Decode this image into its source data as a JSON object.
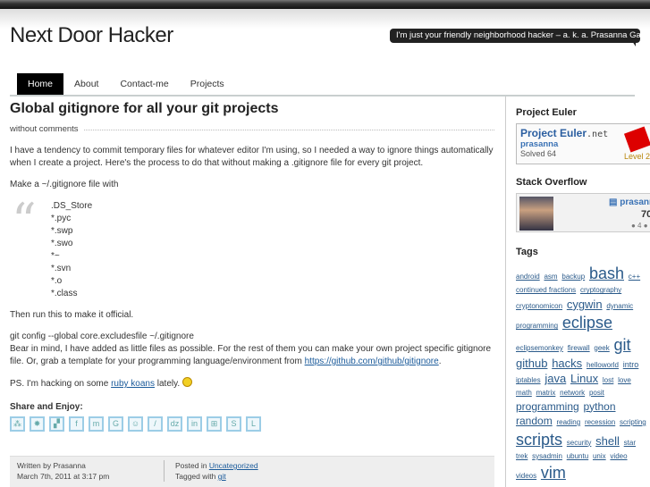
{
  "site": {
    "title": "Next Door Hacker",
    "tagline": "I'm just your friendly neighborhood hacker – a. k. a. Prasanna Gautam"
  },
  "nav": [
    {
      "label": "Home",
      "active": true
    },
    {
      "label": "About"
    },
    {
      "label": "Contact-me"
    },
    {
      "label": "Projects"
    }
  ],
  "post": {
    "title": "Global gitignore for all your git projects",
    "comments": "without comments",
    "p1": "I have a tendency to commit temporary files for whatever editor I'm using, so I needed a way to ignore things automatically when I create a project. Here's the process to do that without making a .gitignore file for every git project.",
    "p2": "Make a ~/.gitignore file with",
    "quote_lines": [
      ".DS_Store",
      "*.pyc",
      "*.swp",
      "*.swo",
      "*~",
      "*.svn",
      "*.o",
      "*.class"
    ],
    "p3": "Then run this to make it official.",
    "p4_cmd": "git config --global core.excludesfile ~/.gitignore",
    "p4_text": "Bear in mind, I have added as little files as possible. For the rest of them you can make your own project specific gitignore file. Or, grab a template for your programming language/environment from ",
    "p4_link": "https://github.com/github/gitignore",
    "p5_pre": "PS. I'm hacking on some ",
    "p5_link": "ruby koans",
    "p5_post": " lately.",
    "share_heading": "Share and Enjoy:",
    "share_icons": [
      "digg-icon",
      "sphinn-icon",
      "delicious-icon",
      "facebook-icon",
      "mixx-icon",
      "google-bookmarks-icon",
      "reddit-icon",
      "blinklist-icon",
      "dzone-icon",
      "linkedin-icon",
      "live-icon",
      "stumbleupon-icon",
      "technorati-icon"
    ]
  },
  "footer": {
    "written_by": "Written by Prasanna",
    "date": "March 7th, 2011 at 3:17 pm",
    "posted_in": "Posted in ",
    "category": "Uncategorized",
    "tagged_with": "Tagged with ",
    "tag": "git"
  },
  "sidebar": {
    "project_euler": {
      "heading": "Project Euler",
      "logo": "Project Euler",
      "net": ".net",
      "user": "prasanna",
      "solved": "Solved 64",
      "level": "Level 2"
    },
    "stack_overflow": {
      "heading": "Stack Overflow",
      "user": "prasanna",
      "rep": "70",
      "badges": "● 4 ●"
    },
    "tags_heading": "Tags",
    "tags": [
      {
        "t": "android",
        "s": 8
      },
      {
        "t": "asm",
        "s": 8
      },
      {
        "t": "backup",
        "s": 8
      },
      {
        "t": "bash",
        "s": 18
      },
      {
        "t": "c++",
        "s": 8
      },
      {
        "t": "continued fractions",
        "s": 8
      },
      {
        "t": "cryptography",
        "s": 8
      },
      {
        "t": "cryptonomicon",
        "s": 8
      },
      {
        "t": "cygwin",
        "s": 13
      },
      {
        "t": "dynamic programming",
        "s": 8
      },
      {
        "t": "eclipse",
        "s": 18
      },
      {
        "t": "eclipsemonkey",
        "s": 8
      },
      {
        "t": "firewall",
        "s": 8
      },
      {
        "t": "geek",
        "s": 8
      },
      {
        "t": "git",
        "s": 18
      },
      {
        "t": "github",
        "s": 13
      },
      {
        "t": "hacks",
        "s": 13
      },
      {
        "t": "helloworld",
        "s": 8
      },
      {
        "t": "intro",
        "s": 9
      },
      {
        "t": "iptables",
        "s": 8
      },
      {
        "t": "java",
        "s": 13
      },
      {
        "t": "Linux",
        "s": 13
      },
      {
        "t": "lost",
        "s": 8
      },
      {
        "t": "love",
        "s": 8
      },
      {
        "t": "math",
        "s": 8
      },
      {
        "t": "matrix",
        "s": 8
      },
      {
        "t": "network",
        "s": 8
      },
      {
        "t": "posit",
        "s": 8
      },
      {
        "t": "programming",
        "s": 12
      },
      {
        "t": "python",
        "s": 12
      },
      {
        "t": "random",
        "s": 12
      },
      {
        "t": "reading",
        "s": 8
      },
      {
        "t": "recession",
        "s": 8
      },
      {
        "t": "scripting",
        "s": 8
      },
      {
        "t": "scripts",
        "s": 18
      },
      {
        "t": "security",
        "s": 8
      },
      {
        "t": "shell",
        "s": 13
      },
      {
        "t": "star trek",
        "s": 8
      },
      {
        "t": "sysadmin",
        "s": 8
      },
      {
        "t": "ubuntu",
        "s": 8
      },
      {
        "t": "unix",
        "s": 8
      },
      {
        "t": "video",
        "s": 8
      },
      {
        "t": "videos",
        "s": 8
      },
      {
        "t": "vim",
        "s": 18
      }
    ]
  }
}
